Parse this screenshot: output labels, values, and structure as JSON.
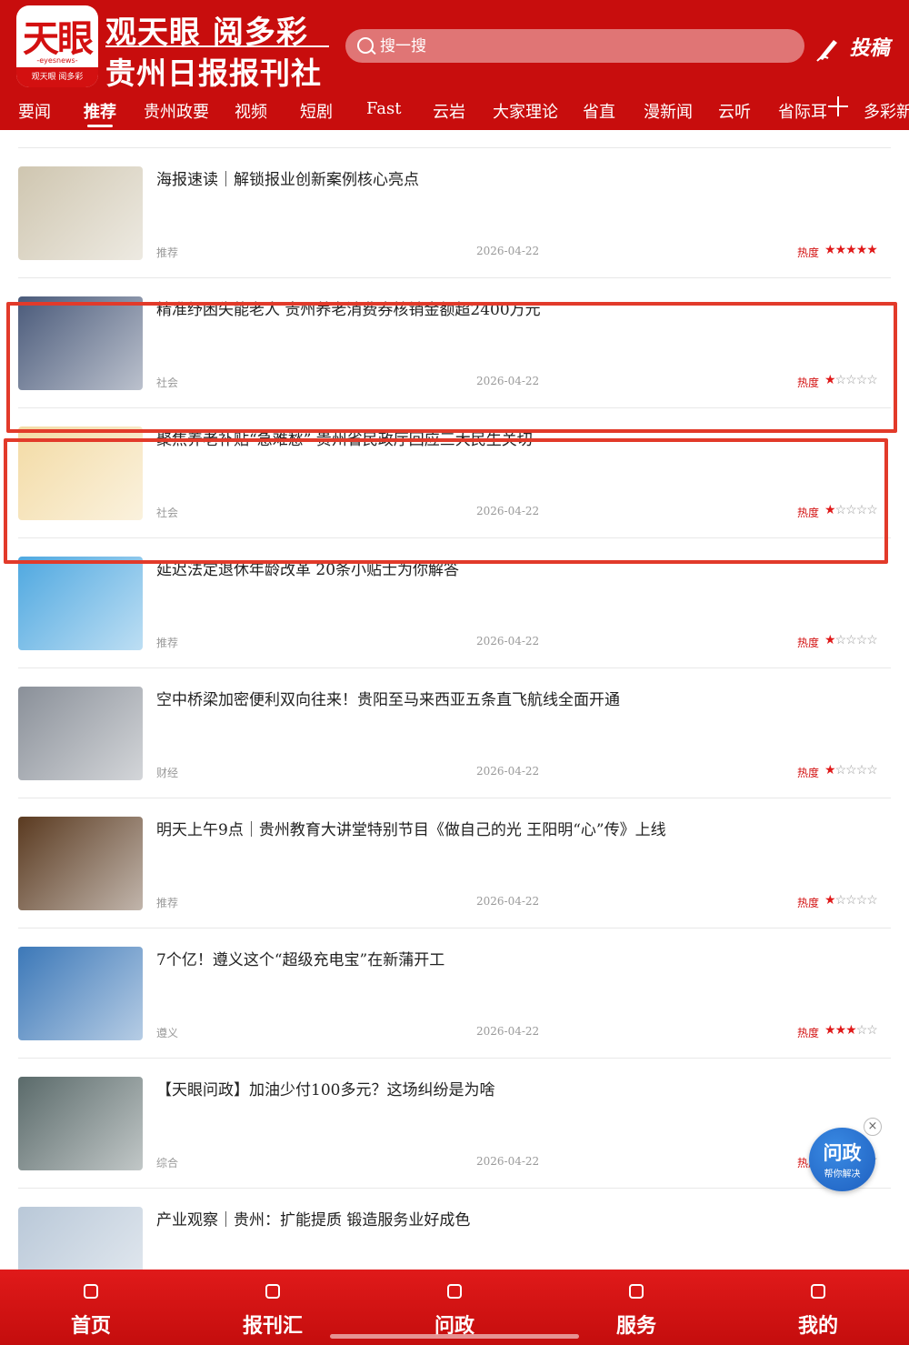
{
  "header": {
    "logo_text": "天眼",
    "logo_sub": "-eyesnews-",
    "logo_strip": "观天眼 阅多彩",
    "brand_line1": "观天眼 阅多彩",
    "brand_line2": "贵州日报报刊社",
    "search_placeholder": "搜一搜",
    "submit_label": "投稿"
  },
  "tabs": [
    {
      "label": "要闻"
    },
    {
      "label": "推荐",
      "active": true
    },
    {
      "label": "贵州政要"
    },
    {
      "label": "视频"
    },
    {
      "label": "短剧"
    },
    {
      "label": "Fast"
    },
    {
      "label": "云岩"
    },
    {
      "label": "大家理论"
    },
    {
      "label": "省直"
    },
    {
      "label": "漫新闻"
    },
    {
      "label": "云听"
    },
    {
      "label": "省际耳"
    },
    {
      "label": "多彩新"
    }
  ],
  "heat_label": "热度",
  "news": [
    {
      "title": "",
      "category": "推荐",
      "date": "2026-04-22",
      "heat": 3,
      "thumb_color": "#d9d2c4"
    },
    {
      "title": "海报速读｜解锁报业创新案例核心亮点",
      "category": "推荐",
      "date": "2026-04-22",
      "heat": 5,
      "thumb_color": "#cfc6b0"
    },
    {
      "title": "精准纾困失能老人 贵州养老消费券核销金额超2400万元",
      "category": "社会",
      "date": "2026-04-22",
      "heat": 1,
      "thumb_color": "#4a5a7a"
    },
    {
      "title": "聚焦养老补贴“急难愁” 贵州省民政厅回应三大民生关切",
      "category": "社会",
      "date": "2026-04-22",
      "heat": 1,
      "thumb_color": "#f3dba5"
    },
    {
      "title": "延迟法定退休年龄改革 20条小贴士为你解答",
      "category": "推荐",
      "date": "2026-04-22",
      "heat": 1,
      "thumb_color": "#4fa8e0"
    },
    {
      "title": "空中桥梁加密便利双向往来！贵阳至马来西亚五条直飞航线全面开通",
      "category": "财经",
      "date": "2026-04-22",
      "heat": 1,
      "thumb_color": "#8a9099"
    },
    {
      "title": "明天上午9点｜贵州教育大讲堂特别节目《做自己的光 王阳明“心”传》上线",
      "category": "推荐",
      "date": "2026-04-22",
      "heat": 1,
      "thumb_color": "#5a3a20"
    },
    {
      "title": "7个亿！遵义这个“超级充电宝”在新蒲开工",
      "category": "遵义",
      "date": "2026-04-22",
      "heat": 3,
      "thumb_color": "#3c78b8"
    },
    {
      "title": "【天眼问政】加油少付100多元？这场纠纷是为啥",
      "category": "综合",
      "date": "2026-04-22",
      "heat": 1,
      "thumb_color": "#5a6a6a"
    },
    {
      "title": "产业观察｜贵州：扩能提质 锻造服务业好成色",
      "category": "",
      "date": "",
      "heat": 0,
      "thumb_color": "#b9c8d8"
    }
  ],
  "float_button": {
    "line1": "问政",
    "line2": "帮你解决",
    "close": "×"
  },
  "bottom_nav": [
    {
      "label": "首页"
    },
    {
      "label": "报刊汇"
    },
    {
      "label": "问政"
    },
    {
      "label": "服务"
    },
    {
      "label": "我的"
    }
  ],
  "colors": {
    "brand_red": "#c80d0d",
    "highlight_box": "#e23a2a",
    "star_on": "#e01919",
    "float_blue": "#1e5fbf"
  }
}
